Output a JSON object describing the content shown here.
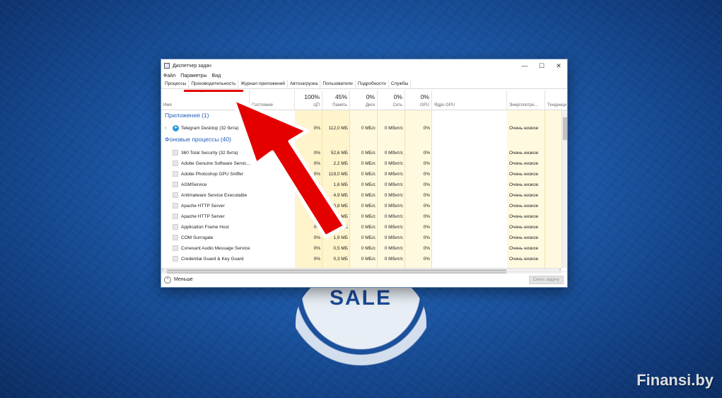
{
  "window": {
    "title": "Диспетчер задач",
    "minimize": "—",
    "maximize": "☐",
    "close": "✕"
  },
  "menu": [
    "Файл",
    "Параметры",
    "Вид"
  ],
  "tabs": [
    "Процессы",
    "Производительность",
    "Журнал приложений",
    "Автозагрузка",
    "Пользователи",
    "Подробности",
    "Службы"
  ],
  "columns": {
    "name": "Имя",
    "status": "Состояние",
    "cpu": {
      "pct": "100%",
      "label": "ЦП"
    },
    "memory": {
      "pct": "45%",
      "label": "Память"
    },
    "disk": {
      "pct": "0%",
      "label": "Диск"
    },
    "network": {
      "pct": "0%",
      "label": "Сеть"
    },
    "gpu": {
      "pct": "0%",
      "label": "GPU"
    },
    "gpu_engine": "Ядро GPU",
    "power": "Энергопотре...",
    "power_trend": "Тенденци"
  },
  "groups": {
    "apps": "Приложения (1)",
    "background": "Фоновые процессы (40)"
  },
  "apps": [
    {
      "name": "Telegram Desktop (32 бита)",
      "cpu": "0%",
      "mem": "112,0 МБ",
      "disk": "0 МБ/с",
      "net": "0 Мбит/с",
      "gpu": "0%",
      "power": "Очень низкое"
    }
  ],
  "processes": [
    {
      "name": "360 Total Security (32 бита)",
      "cpu": "0%",
      "mem": "52,6 МБ",
      "disk": "0 МБ/с",
      "net": "0 Мбит/с",
      "gpu": "0%",
      "power": "Очень низкое"
    },
    {
      "name": "Adobe Genuine Software Servic...",
      "cpu": "0%",
      "mem": "2,2 МБ",
      "disk": "0 МБ/с",
      "net": "0 Мбит/с",
      "gpu": "0%",
      "power": "Очень низкое"
    },
    {
      "name": "Adobe Photoshop GPU Sniffer",
      "cpu": "0%",
      "mem": "119,0 МБ",
      "disk": "0 МБ/с",
      "net": "0 Мбит/с",
      "gpu": "0%",
      "power": "Очень низкое"
    },
    {
      "name": "AGMService",
      "cpu": "0%",
      "mem": "1,6 МБ",
      "disk": "0 МБ/с",
      "net": "0 Мбит/с",
      "gpu": "0%",
      "power": "Очень низкое"
    },
    {
      "name": "Antimalware Service Executable",
      "cpu": "0%",
      "mem": "4,9 МБ",
      "disk": "0 МБ/с",
      "net": "0 Мбит/с",
      "gpu": "0%",
      "power": "Очень низкое"
    },
    {
      "name": "Apache HTTP Server",
      "cpu": "0%",
      "mem": "0,8 МБ",
      "disk": "0 МБ/с",
      "net": "0 Мбит/с",
      "gpu": "0%",
      "power": "Очень низкое"
    },
    {
      "name": "Apache HTTP Server",
      "cpu": "0%",
      "mem": "0,3 МБ",
      "disk": "0 МБ/с",
      "net": "0 Мбит/с",
      "gpu": "0%",
      "power": "Очень низкое"
    },
    {
      "name": "Application Frame Host",
      "cpu": "0%",
      "mem": "0,7 МБ",
      "disk": "0 МБ/с",
      "net": "0 Мбит/с",
      "gpu": "0%",
      "power": "Очень низкое"
    },
    {
      "name": "COM Surrogate",
      "cpu": "0%",
      "mem": "1,9 МБ",
      "disk": "0 МБ/с",
      "net": "0 Мбит/с",
      "gpu": "0%",
      "power": "Очень низкое"
    },
    {
      "name": "Conexant Audio Message Service",
      "cpu": "0%",
      "mem": "0,5 МБ",
      "disk": "0 МБ/с",
      "net": "0 Мбит/с",
      "gpu": "0%",
      "power": "Очень низкое"
    },
    {
      "name": "Credential Guard & Key Guard",
      "cpu": "0%",
      "mem": "0,3 МБ",
      "disk": "0 МБ/с",
      "net": "0 Мбит/с",
      "gpu": "0%",
      "power": "Очень низкое"
    }
  ],
  "footer": {
    "less": "Меньше",
    "end_task": "Снять задачу"
  },
  "background": {
    "logo_text": "SALE",
    "watermark": "Finansi.by"
  },
  "colors": {
    "arrow": "#e50000",
    "cell_highlight": "#fff4cc",
    "group_title": "#2660b8"
  }
}
